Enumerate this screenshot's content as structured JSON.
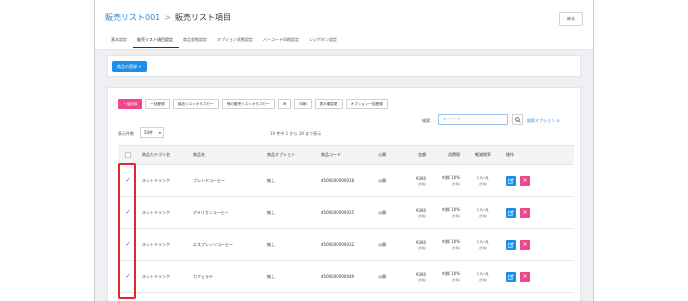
{
  "header": {
    "breadcrumb_parent": "販売リスト001",
    "breadcrumb_sep": ">",
    "breadcrumb_current": "販売リスト項目",
    "back_label": "戻る"
  },
  "tabs": [
    {
      "label": "基本設定"
    },
    {
      "label": "販売リスト項目設定",
      "active": true
    },
    {
      "label": "商品状態設定"
    },
    {
      "label": "オプション状態設定"
    },
    {
      "label": "バーコード印刷設定"
    },
    {
      "label": "レジボタン設定"
    }
  ],
  "register_label": "商品の登録 +",
  "actions": [
    {
      "label": "一括削除",
      "primary": true
    },
    {
      "label": "一括登録"
    },
    {
      "label": "商品リストからコピー"
    },
    {
      "label": "他の販売リストからコピー"
    },
    {
      "label": "IR"
    },
    {
      "label": "印刷"
    },
    {
      "label": "表示順変更"
    },
    {
      "label": "オプション一括登録"
    }
  ],
  "search": {
    "label": "検索:",
    "placeholder": "キーワード",
    "option_label": "検索オプション"
  },
  "paging": {
    "count_label": "表示件数",
    "count_value": "50件",
    "range_text": "19 件中 1 から 19 まで表示"
  },
  "table": {
    "columns": [
      "商品カテゴリ名",
      "商品名",
      "商品オプション",
      "商品コード",
      "公開",
      "金額",
      "消費税",
      "軽減税率",
      "操作"
    ],
    "rows": [
      {
        "category": "ホットドリンク",
        "name": "ブレンドコーヒー",
        "option": "無し",
        "code": "4500000000018",
        "public": "公開",
        "price": "¥300",
        "price_sub": "(外税)",
        "tax": "内税 10%",
        "tax_sub": "(外税)",
        "reduced": "いいえ",
        "reduced_sub": "(外税)"
      },
      {
        "category": "ホットドリンク",
        "name": "アメリカンコーヒー",
        "option": "無し",
        "code": "4500000000025",
        "public": "公開",
        "price": "¥300",
        "price_sub": "(外税)",
        "tax": "内税 10%",
        "tax_sub": "(外税)",
        "reduced": "いいえ",
        "reduced_sub": "(外税)"
      },
      {
        "category": "ホットドリンク",
        "name": "エスプレッソコーヒー",
        "option": "無し",
        "code": "4500000000032",
        "public": "公開",
        "price": "¥300",
        "price_sub": "(外税)",
        "tax": "内税 10%",
        "tax_sub": "(外税)",
        "reduced": "いいえ",
        "reduced_sub": "(外税)"
      },
      {
        "category": "ホットドリンク",
        "name": "カフェラテ",
        "option": "無し",
        "code": "4500000000049",
        "public": "公開",
        "price": "¥300",
        "price_sub": "(外税)",
        "tax": "内税 10%",
        "tax_sub": "(外税)",
        "reduced": "いいえ",
        "reduced_sub": "(外税)"
      }
    ]
  },
  "colors": {
    "accent": "#1e8ee8",
    "danger": "#f0468c",
    "highlight": "#e1262c"
  }
}
